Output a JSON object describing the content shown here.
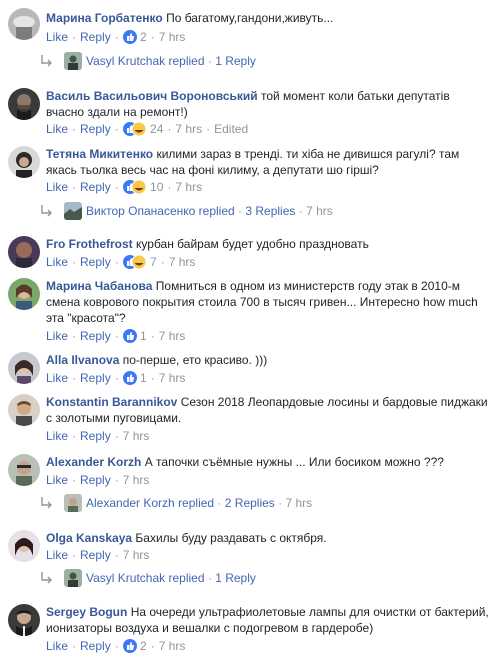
{
  "labels": {
    "like": "Like",
    "reply": "Reply",
    "edited": "Edited"
  },
  "comments": [
    {
      "author": "Марина Горбатенко",
      "text": "По багатому,гандони,живуть...",
      "reactions": "2",
      "time": "7 hrs"
    },
    {
      "author": "Василь Васильович Вороновський",
      "text": "той момент коли батьки депутатів вчасно здали на ремонт!)",
      "reactions": "24",
      "time": "7 hrs"
    },
    {
      "author": "Тетяна Микитенко",
      "text": "килими зараз в тренді. ти хіба не дивишся рагулі? там якась тьолка весь час на фоні килиму, а депутати шо гірші?",
      "reactions": "10",
      "time": "7 hrs"
    },
    {
      "author": "Fro Frothefrost",
      "text": "курбан байрам будет удобно праздновать",
      "reactions": "7",
      "time": "7 hrs"
    },
    {
      "author": "Марина Чабанова",
      "text": "Помниться в одном из министерств году этак в 2010-м смена коврового покрытия стоила 700 в тысяч гривен... Интересно how much эта \"красота\"?",
      "reactions": "1",
      "time": "7 hrs"
    },
    {
      "author": "Alla Ilvanova",
      "text": "по-перше, ето красиво. )))",
      "reactions": "1",
      "time": "7 hrs"
    },
    {
      "author": "Konstantin Barannikov",
      "text": "Сезон 2018 Леопардовые лосины и бардовые пиджаки с золотыми пуговицами.",
      "reactions": "",
      "time": "7 hrs"
    },
    {
      "author": "Alexander Korzh",
      "text": "А тапочки съёмные нужны ... Или босиком можно ???",
      "reactions": "",
      "time": "7 hrs"
    },
    {
      "author": "Olga Kanskaya",
      "text": "Бахилы буду раздавать с октября.",
      "reactions": "",
      "time": "7 hrs"
    },
    {
      "author": "Sergey Bogun",
      "text": "На очереди ультрафиолетовые лампы для очистки от бактерий, ионизаторы воздуха и вешалки с подогревом в гардеробе)",
      "reactions": "2",
      "time": "7 hrs"
    }
  ],
  "replies": [
    {
      "name": "Vasyl Krutchak",
      "action": "replied",
      "count": "1 Reply",
      "time": ""
    },
    {
      "name": "Виктор Опанасенко",
      "action": "replied",
      "count": "3 Replies",
      "time": "7 hrs"
    },
    {
      "name": "Alexander Korzh",
      "action": "replied",
      "count": "2 Replies",
      "time": "7 hrs"
    },
    {
      "name": "Vasyl Krutchak",
      "action": "replied",
      "count": "1 Reply",
      "time": ""
    }
  ],
  "colors": {
    "link": "#4267b2",
    "author": "#385898",
    "meta": "#90949c",
    "like_blue": "#3b78f5",
    "haha_yellow": "#f7c944"
  }
}
